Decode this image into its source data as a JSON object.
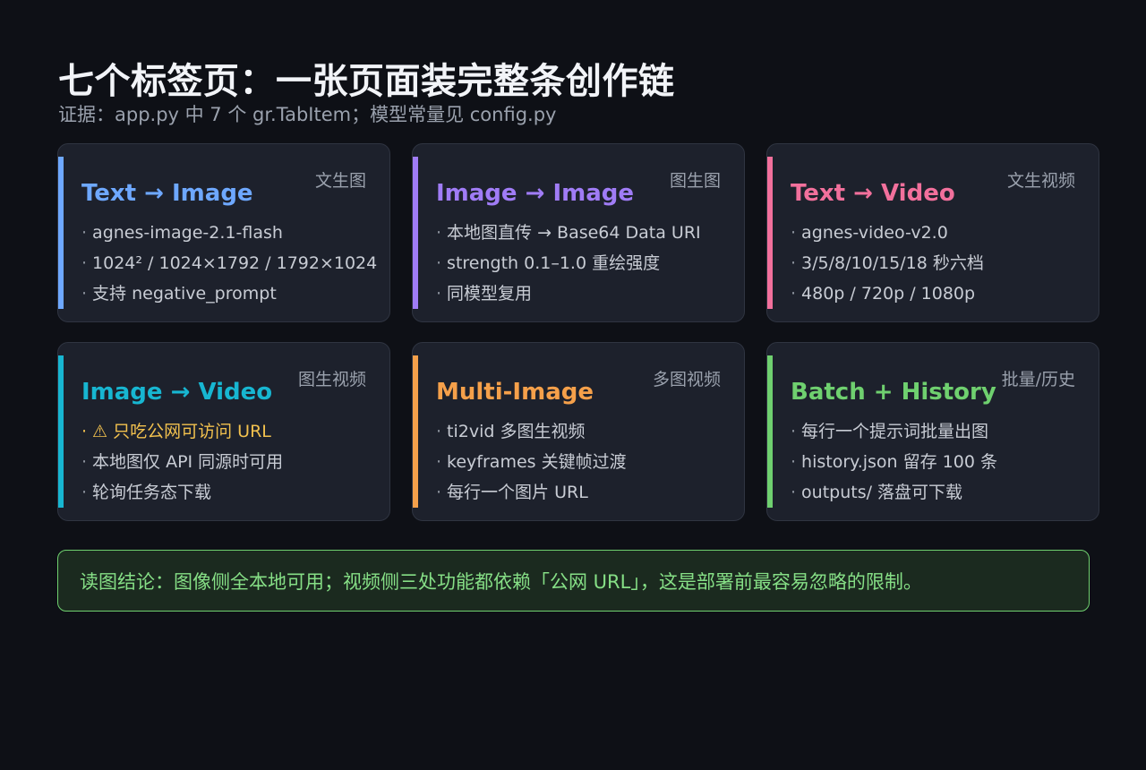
{
  "page": {
    "title": "七个标签页：一张页面装完整条创作链",
    "subtitle": "证据：app.py 中 7 个 gr.TabItem；模型常量见 config.py"
  },
  "cards": [
    {
      "tag": "文生图",
      "title": "Text → Image",
      "accent": "#6ea8ff",
      "items": [
        "agnes-image-2.1-flash",
        "1024² / 1024×1792 / 1792×1024",
        "支持 negative_prompt"
      ]
    },
    {
      "tag": "图生图",
      "title": "Image → Image",
      "accent": "#a07cf6",
      "items": [
        "本地图直传 → Base64 Data URI",
        "strength 0.1–1.0 重绘强度",
        "同模型复用"
      ]
    },
    {
      "tag": "文生视频",
      "title": "Text → Video",
      "accent": "#f2709c",
      "items": [
        "agnes-video-v2.0",
        "3/5/8/10/15/18 秒六档",
        "480p / 720p / 1080p"
      ]
    },
    {
      "tag": "图生视频",
      "title": "Image → Video",
      "accent": "#17b6d1",
      "items": [
        "⚠ 只吃公网可访问 URL",
        "本地图仅 API 同源时可用",
        "轮询任务态下载"
      ]
    },
    {
      "tag": "多图视频",
      "title": "Multi-Image",
      "accent": "#f5a04a",
      "items": [
        "ti2vid 多图生视频",
        "keyframes 关键帧过渡",
        "每行一个图片 URL"
      ]
    },
    {
      "tag": "批量/历史",
      "title": "Batch + History",
      "accent": "#6fd06f",
      "items": [
        "每行一个提示词批量出图",
        "history.json 留存 100 条",
        "outputs/ 落盘可下载"
      ]
    }
  ],
  "conclusion": "读图结论：图像侧全本地可用；视频侧三处功能都依赖「公网 URL」，这是部署前最容易忽略的限制。"
}
